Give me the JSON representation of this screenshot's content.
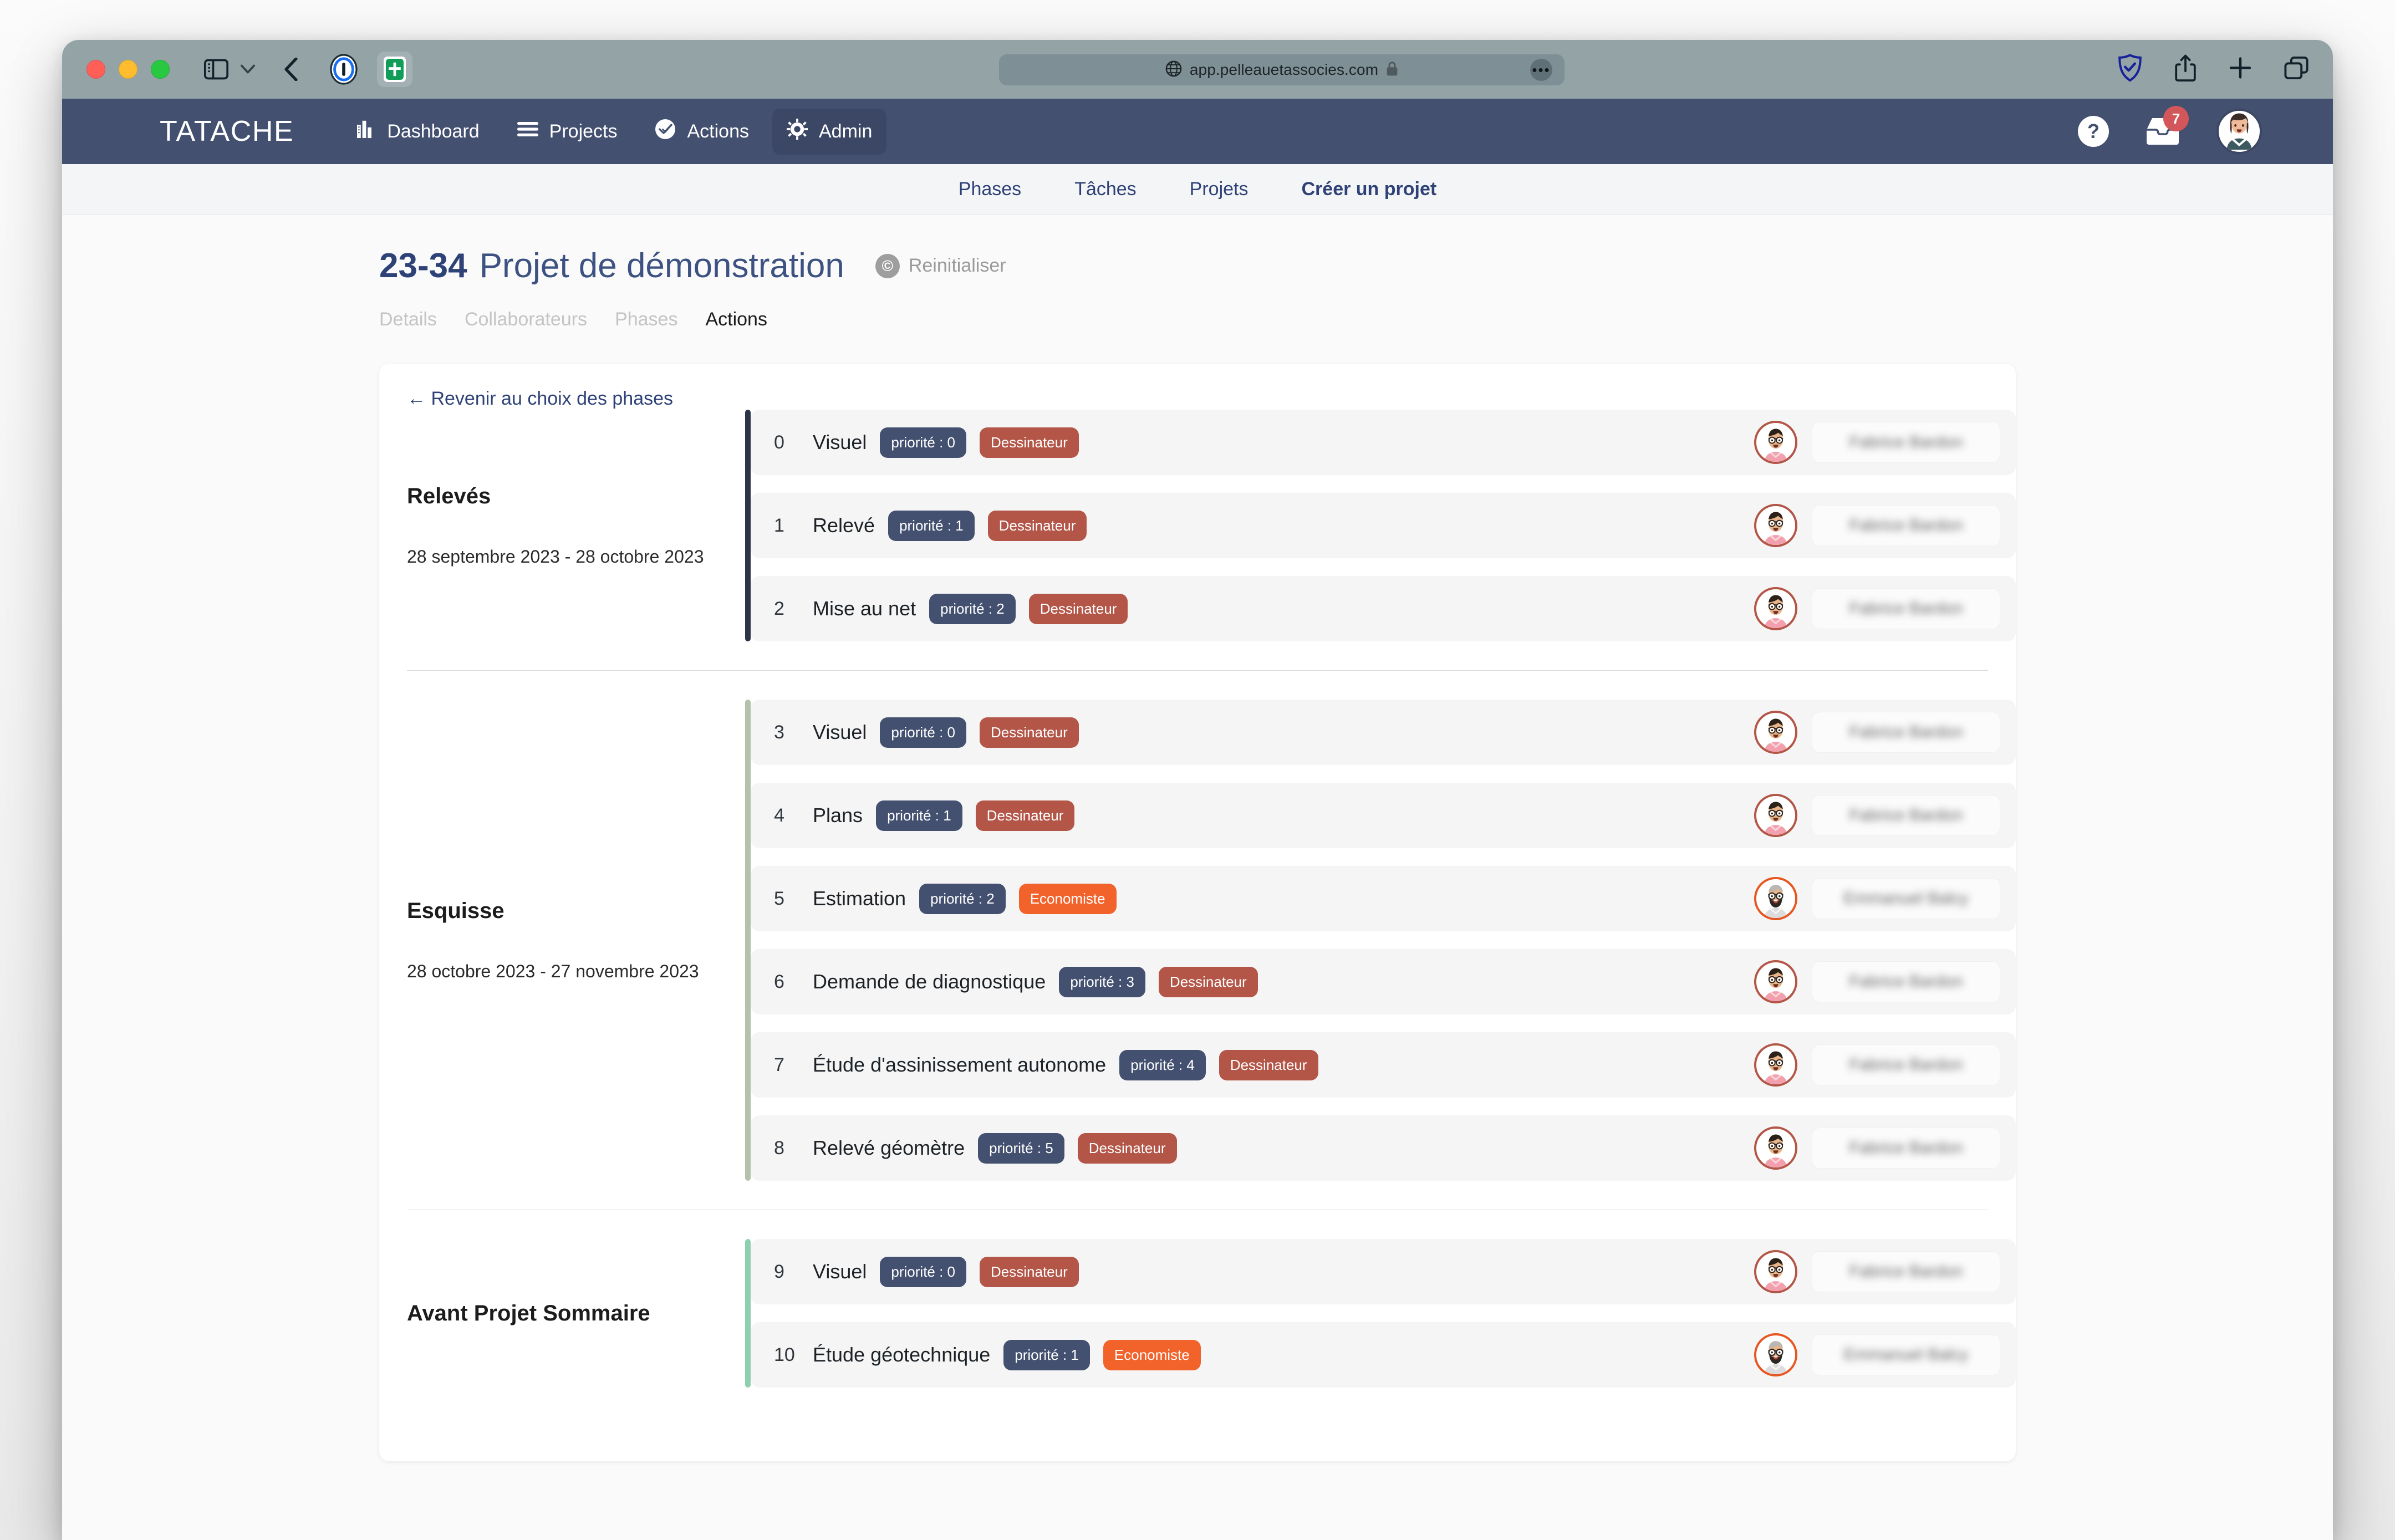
{
  "browser": {
    "url": "app.pelleauetassocies.com",
    "icons": {
      "sidebar": "sidebar-toggle-icon",
      "chevron": "chevron-down-icon",
      "back": "back-chevron-icon",
      "reader": "reader-view-icon",
      "favicon": "tatache-favicon-icon",
      "globe": "globe-icon",
      "lock": "lock-icon",
      "more": "more-options-icon",
      "shield": "privacy-shield-icon",
      "share": "share-icon",
      "newtab": "new-tab-plus-icon",
      "tabs": "tab-overview-icon"
    }
  },
  "app_nav": {
    "brand": "TATACHE",
    "items": [
      {
        "label": "Dashboard",
        "icon": "chart-bars-icon",
        "active": false
      },
      {
        "label": "Projects",
        "icon": "list-lines-icon",
        "active": false
      },
      {
        "label": "Actions",
        "icon": "check-circle-icon",
        "active": false
      },
      {
        "label": "Admin",
        "icon": "gear-icon",
        "active": true
      }
    ],
    "help_label": "?",
    "notifications_count": "7",
    "avatar_name": "user-avatar"
  },
  "sub_nav": {
    "items": [
      {
        "label": "Phases",
        "bold": false
      },
      {
        "label": "Tâches",
        "bold": false
      },
      {
        "label": "Projets",
        "bold": false
      },
      {
        "label": "Créer un projet",
        "bold": true
      }
    ]
  },
  "page": {
    "title_code": "23-34",
    "title_name": "Projet de démonstration",
    "reset_label": "Reinitialiser",
    "reset_icon_glyph": "©",
    "tabs": [
      {
        "label": "Details",
        "active": false
      },
      {
        "label": "Collaborateurs",
        "active": false
      },
      {
        "label": "Phases",
        "active": false
      },
      {
        "label": "Actions",
        "active": true
      }
    ],
    "back_link": "← Revenir au choix des phases"
  },
  "colors": {
    "nav_bg": "#435070",
    "nav_active": "#3b4765",
    "priority_badge": "#435070",
    "role_dessinateur": "#b35547",
    "role_economiste": "#f2622b",
    "badge_notif": "#d3565a",
    "bar_releves": "#2c3548",
    "bar_esquisse": "#b5c2ab",
    "bar_aps": "#8ed0ae",
    "link_blue": "#2f4277",
    "row_bg": "#f5f5f5"
  },
  "phases": [
    {
      "name": "Relevés",
      "dates": "28 septembre 2023 - 28 octobre 2023",
      "bar_color": "#2c3548",
      "rows": [
        {
          "index": "0",
          "title": "Visuel",
          "priority": "priorité : 0",
          "role": "Dessinateur",
          "role_kind": "dessinateur",
          "assignee": "Fabrice Bardon"
        },
        {
          "index": "1",
          "title": "Relevé",
          "priority": "priorité : 1",
          "role": "Dessinateur",
          "role_kind": "dessinateur",
          "assignee": "Fabrice Bardon"
        },
        {
          "index": "2",
          "title": "Mise au net",
          "priority": "priorité : 2",
          "role": "Dessinateur",
          "role_kind": "dessinateur",
          "assignee": "Fabrice Bardon"
        }
      ]
    },
    {
      "name": "Esquisse",
      "dates": "28 octobre 2023 - 27 novembre 2023",
      "bar_color": "#b5c2ab",
      "rows": [
        {
          "index": "3",
          "title": "Visuel",
          "priority": "priorité : 0",
          "role": "Dessinateur",
          "role_kind": "dessinateur",
          "assignee": "Fabrice Bardon"
        },
        {
          "index": "4",
          "title": "Plans",
          "priority": "priorité : 1",
          "role": "Dessinateur",
          "role_kind": "dessinateur",
          "assignee": "Fabrice Bardon"
        },
        {
          "index": "5",
          "title": "Estimation",
          "priority": "priorité : 2",
          "role": "Economiste",
          "role_kind": "economiste",
          "assignee": "Emmanuel Balcy"
        },
        {
          "index": "6",
          "title": "Demande de diagnostique",
          "priority": "priorité : 3",
          "role": "Dessinateur",
          "role_kind": "dessinateur",
          "assignee": "Fabrice Bardon"
        },
        {
          "index": "7",
          "title": "Étude d'assinissement autonome",
          "priority": "priorité : 4",
          "role": "Dessinateur",
          "role_kind": "dessinateur",
          "assignee": "Fabrice Bardon"
        },
        {
          "index": "8",
          "title": "Relevé géomètre",
          "priority": "priorité : 5",
          "role": "Dessinateur",
          "role_kind": "dessinateur",
          "assignee": "Fabrice Bardon"
        }
      ]
    },
    {
      "name": "Avant Projet Sommaire",
      "dates": "",
      "bar_color": "#8ed0ae",
      "rows": [
        {
          "index": "9",
          "title": "Visuel",
          "priority": "priorité : 0",
          "role": "Dessinateur",
          "role_kind": "dessinateur",
          "assignee": "Fabrice Bardon"
        },
        {
          "index": "10",
          "title": "Étude géotechnique",
          "priority": "priorité : 1",
          "role": "Economiste",
          "role_kind": "economiste",
          "assignee": "Emmanuel Balcy"
        }
      ]
    }
  ]
}
